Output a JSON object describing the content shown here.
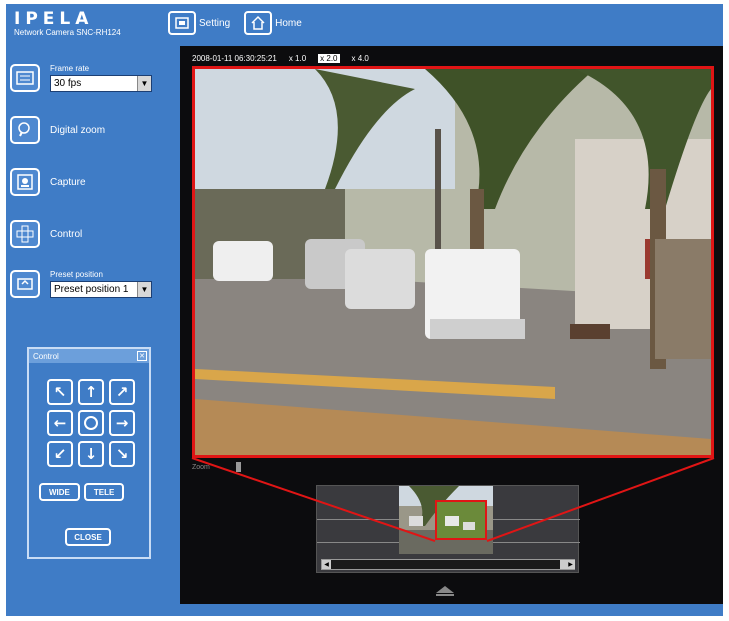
{
  "brand": {
    "logo": "IPELA",
    "model": "Network Camera SNC-RH124"
  },
  "topnav": {
    "setting_label": "Setting",
    "home_label": "Home"
  },
  "sidebar": {
    "frame_rate": {
      "label": "Frame rate",
      "value": "30 fps"
    },
    "digital_zoom": {
      "label": "Digital zoom"
    },
    "capture": {
      "label": "Capture"
    },
    "control": {
      "label": "Control"
    },
    "preset": {
      "label": "Preset position",
      "value": "Preset position 1"
    }
  },
  "control_panel": {
    "title": "Control",
    "buttons": [
      "↖",
      "↑",
      "↗",
      "←",
      "",
      "→",
      "↙",
      "↓",
      "↘"
    ],
    "wide_label": "WIDE",
    "tele_label": "TELE",
    "close_label": "CLOSE"
  },
  "viewer": {
    "timestamp": "2008-01-11 06:30:25:21",
    "zoom_mode": "x 2.0",
    "zoom_levels": [
      "x 1.0",
      "x 2.0",
      "x 4.0"
    ],
    "slider_label": "Zoom"
  },
  "colors": {
    "app_bg": "#3f7cc6",
    "viewer_bg": "#0c0c0e",
    "highlight": "#e01515"
  }
}
